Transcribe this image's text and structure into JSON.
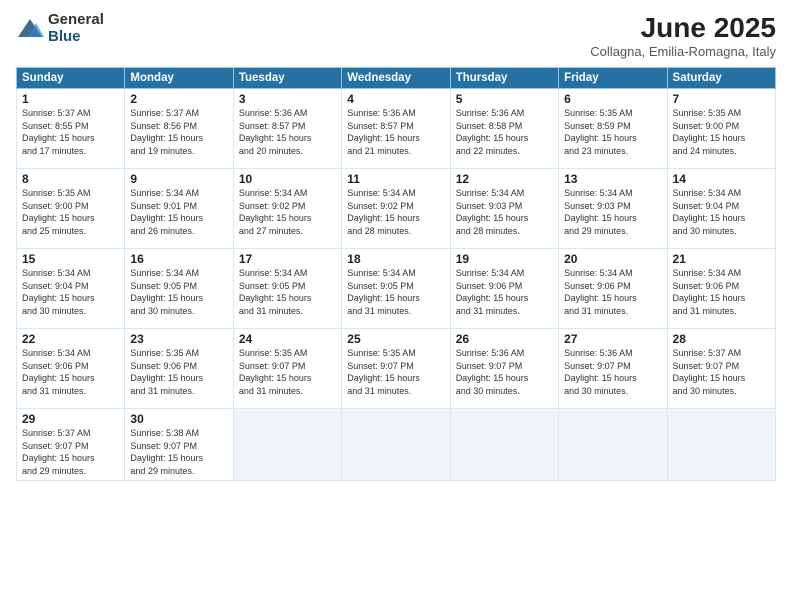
{
  "logo": {
    "general": "General",
    "blue": "Blue"
  },
  "title": "June 2025",
  "subtitle": "Collagna, Emilia-Romagna, Italy",
  "headers": [
    "Sunday",
    "Monday",
    "Tuesday",
    "Wednesday",
    "Thursday",
    "Friday",
    "Saturday"
  ],
  "weeks": [
    [
      {
        "day": "1",
        "info": "Sunrise: 5:37 AM\nSunset: 8:55 PM\nDaylight: 15 hours\nand 17 minutes."
      },
      {
        "day": "2",
        "info": "Sunrise: 5:37 AM\nSunset: 8:56 PM\nDaylight: 15 hours\nand 19 minutes."
      },
      {
        "day": "3",
        "info": "Sunrise: 5:36 AM\nSunset: 8:57 PM\nDaylight: 15 hours\nand 20 minutes."
      },
      {
        "day": "4",
        "info": "Sunrise: 5:36 AM\nSunset: 8:57 PM\nDaylight: 15 hours\nand 21 minutes."
      },
      {
        "day": "5",
        "info": "Sunrise: 5:36 AM\nSunset: 8:58 PM\nDaylight: 15 hours\nand 22 minutes."
      },
      {
        "day": "6",
        "info": "Sunrise: 5:35 AM\nSunset: 8:59 PM\nDaylight: 15 hours\nand 23 minutes."
      },
      {
        "day": "7",
        "info": "Sunrise: 5:35 AM\nSunset: 9:00 PM\nDaylight: 15 hours\nand 24 minutes."
      }
    ],
    [
      {
        "day": "8",
        "info": "Sunrise: 5:35 AM\nSunset: 9:00 PM\nDaylight: 15 hours\nand 25 minutes."
      },
      {
        "day": "9",
        "info": "Sunrise: 5:34 AM\nSunset: 9:01 PM\nDaylight: 15 hours\nand 26 minutes."
      },
      {
        "day": "10",
        "info": "Sunrise: 5:34 AM\nSunset: 9:02 PM\nDaylight: 15 hours\nand 27 minutes."
      },
      {
        "day": "11",
        "info": "Sunrise: 5:34 AM\nSunset: 9:02 PM\nDaylight: 15 hours\nand 28 minutes."
      },
      {
        "day": "12",
        "info": "Sunrise: 5:34 AM\nSunset: 9:03 PM\nDaylight: 15 hours\nand 28 minutes."
      },
      {
        "day": "13",
        "info": "Sunrise: 5:34 AM\nSunset: 9:03 PM\nDaylight: 15 hours\nand 29 minutes."
      },
      {
        "day": "14",
        "info": "Sunrise: 5:34 AM\nSunset: 9:04 PM\nDaylight: 15 hours\nand 30 minutes."
      }
    ],
    [
      {
        "day": "15",
        "info": "Sunrise: 5:34 AM\nSunset: 9:04 PM\nDaylight: 15 hours\nand 30 minutes."
      },
      {
        "day": "16",
        "info": "Sunrise: 5:34 AM\nSunset: 9:05 PM\nDaylight: 15 hours\nand 30 minutes."
      },
      {
        "day": "17",
        "info": "Sunrise: 5:34 AM\nSunset: 9:05 PM\nDaylight: 15 hours\nand 31 minutes."
      },
      {
        "day": "18",
        "info": "Sunrise: 5:34 AM\nSunset: 9:05 PM\nDaylight: 15 hours\nand 31 minutes."
      },
      {
        "day": "19",
        "info": "Sunrise: 5:34 AM\nSunset: 9:06 PM\nDaylight: 15 hours\nand 31 minutes."
      },
      {
        "day": "20",
        "info": "Sunrise: 5:34 AM\nSunset: 9:06 PM\nDaylight: 15 hours\nand 31 minutes."
      },
      {
        "day": "21",
        "info": "Sunrise: 5:34 AM\nSunset: 9:06 PM\nDaylight: 15 hours\nand 31 minutes."
      }
    ],
    [
      {
        "day": "22",
        "info": "Sunrise: 5:34 AM\nSunset: 9:06 PM\nDaylight: 15 hours\nand 31 minutes."
      },
      {
        "day": "23",
        "info": "Sunrise: 5:35 AM\nSunset: 9:06 PM\nDaylight: 15 hours\nand 31 minutes."
      },
      {
        "day": "24",
        "info": "Sunrise: 5:35 AM\nSunset: 9:07 PM\nDaylight: 15 hours\nand 31 minutes."
      },
      {
        "day": "25",
        "info": "Sunrise: 5:35 AM\nSunset: 9:07 PM\nDaylight: 15 hours\nand 31 minutes."
      },
      {
        "day": "26",
        "info": "Sunrise: 5:36 AM\nSunset: 9:07 PM\nDaylight: 15 hours\nand 30 minutes."
      },
      {
        "day": "27",
        "info": "Sunrise: 5:36 AM\nSunset: 9:07 PM\nDaylight: 15 hours\nand 30 minutes."
      },
      {
        "day": "28",
        "info": "Sunrise: 5:37 AM\nSunset: 9:07 PM\nDaylight: 15 hours\nand 30 minutes."
      }
    ],
    [
      {
        "day": "29",
        "info": "Sunrise: 5:37 AM\nSunset: 9:07 PM\nDaylight: 15 hours\nand 29 minutes."
      },
      {
        "day": "30",
        "info": "Sunrise: 5:38 AM\nSunset: 9:07 PM\nDaylight: 15 hours\nand 29 minutes."
      },
      null,
      null,
      null,
      null,
      null
    ]
  ]
}
